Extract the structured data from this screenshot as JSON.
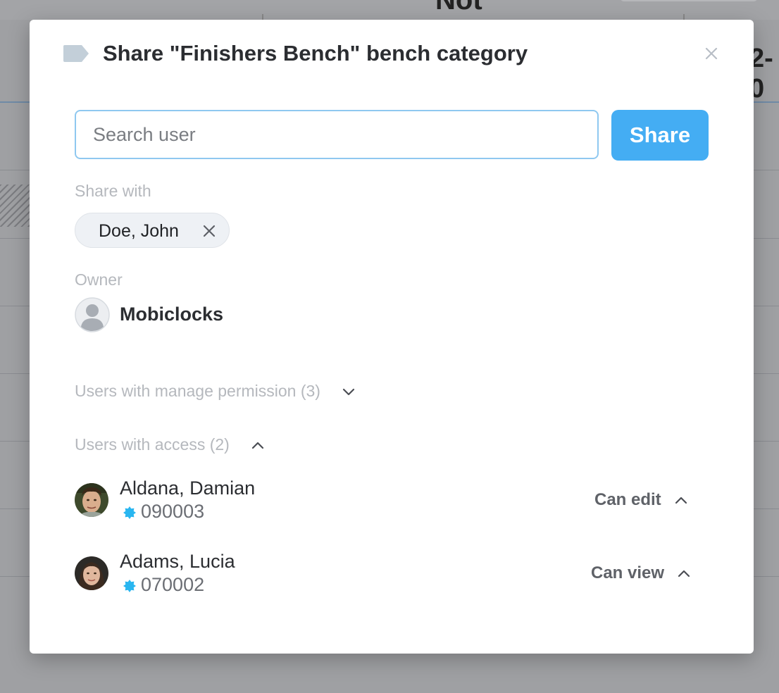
{
  "background": {
    "top_text": "Not",
    "right_text": "2-0"
  },
  "dialog": {
    "title": "Share \"Finishers Bench\" bench category",
    "title_icon": "tag-icon",
    "close_icon": "close-icon"
  },
  "search": {
    "placeholder": "Search user",
    "value": ""
  },
  "share_button": {
    "label": "Share",
    "color": "#44adf3"
  },
  "share_with": {
    "label": "Share with",
    "chips": [
      {
        "label": "Doe, John"
      }
    ]
  },
  "owner": {
    "label": "Owner",
    "name": "Mobiclocks",
    "avatar_icon": "default-user-avatar-icon"
  },
  "manage_section": {
    "label": "Users with manage permission (3)",
    "expanded": false
  },
  "access_section": {
    "label": "Users with access (2)",
    "expanded": true,
    "users": [
      {
        "name": "Aldana, Damian",
        "id": "090003",
        "permission": "Can edit"
      },
      {
        "name": "Adams, Lucia",
        "id": "070002",
        "permission": "Can view"
      }
    ]
  },
  "colors": {
    "accent": "#44adf3",
    "badge": "#29b6f0",
    "input_border": "#8fc8f0"
  }
}
